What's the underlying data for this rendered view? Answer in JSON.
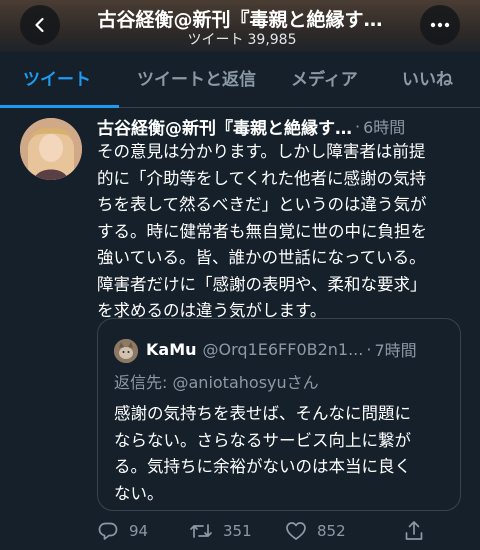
{
  "header": {
    "title": "古谷経衡@新刊『毒親と絶縁す…",
    "tweets_label": "ツイート",
    "tweets_count": "39,985"
  },
  "tabs": [
    {
      "label": "ツイート"
    },
    {
      "label": "ツイートと返信"
    },
    {
      "label": "メディア"
    },
    {
      "label": "いいね"
    }
  ],
  "tweet": {
    "author": "古谷経衡@新刊『毒親と絶縁す…",
    "dot": "·",
    "time": "6時間",
    "lines": [
      "その意見は分かります。しかし障害者は前提",
      "的に「介助等をしてくれた他者に感謝の気持",
      "ちを表して然るべきだ」というのは違う気が",
      "する。時に健常者も無自覚に世の中に負担を",
      "強いている。皆、誰かの世話になっている。",
      "障害者だけに「感謝の表明や、柔和な要求」",
      "を求めるのは違う気がします。"
    ]
  },
  "quote": {
    "name": "KaMu",
    "handle": "@Orq1E6FF0B2n1...",
    "dot": "·",
    "time": "7時間",
    "reply_prefix": "返信先:",
    "reply_to": "@aniotahosyu",
    "reply_suffix": "さん",
    "lines": [
      "感謝の気持ちを表せば、そんなに問題に",
      "ならない。さらなるサービス向上に繋が",
      "る。気持ちに余裕がないのは本当に良く",
      "ない。"
    ]
  },
  "actions": {
    "replies": "94",
    "retweets": "351",
    "likes": "852"
  },
  "colors": {
    "background": "#15202b",
    "accent": "#1d9bf0",
    "muted": "#8b98a5",
    "border": "#38444d"
  }
}
